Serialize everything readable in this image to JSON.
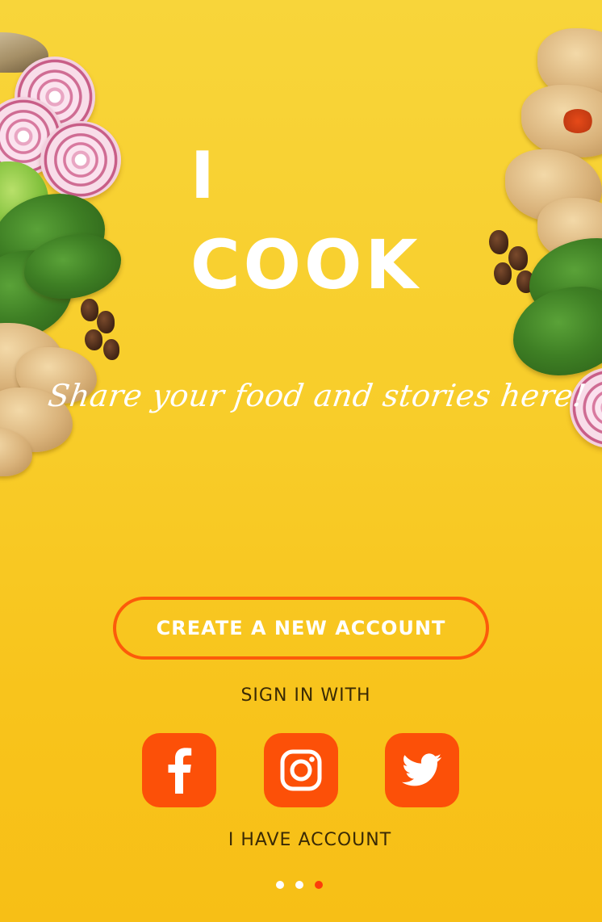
{
  "app": {
    "title_line1": "I",
    "title_line2": "COOK",
    "tagline": "Share your food and stories here!"
  },
  "actions": {
    "create_account_label": "CREATE A NEW ACCOUNT",
    "sign_in_with_label": "SIGN IN WITH",
    "have_account_label": "I HAVE ACCOUNT"
  },
  "social": [
    {
      "name": "facebook",
      "icon": "facebook-icon"
    },
    {
      "name": "instagram",
      "icon": "instagram-icon"
    },
    {
      "name": "twitter",
      "icon": "twitter-icon"
    }
  ],
  "pager": {
    "total": 3,
    "active_index": 2
  },
  "colors": {
    "background": "#f8cd2a",
    "accent": "#fc5008",
    "text_light": "#ffffff",
    "text_dark": "#3a2a05",
    "active_dot": "#fc3d0a"
  }
}
